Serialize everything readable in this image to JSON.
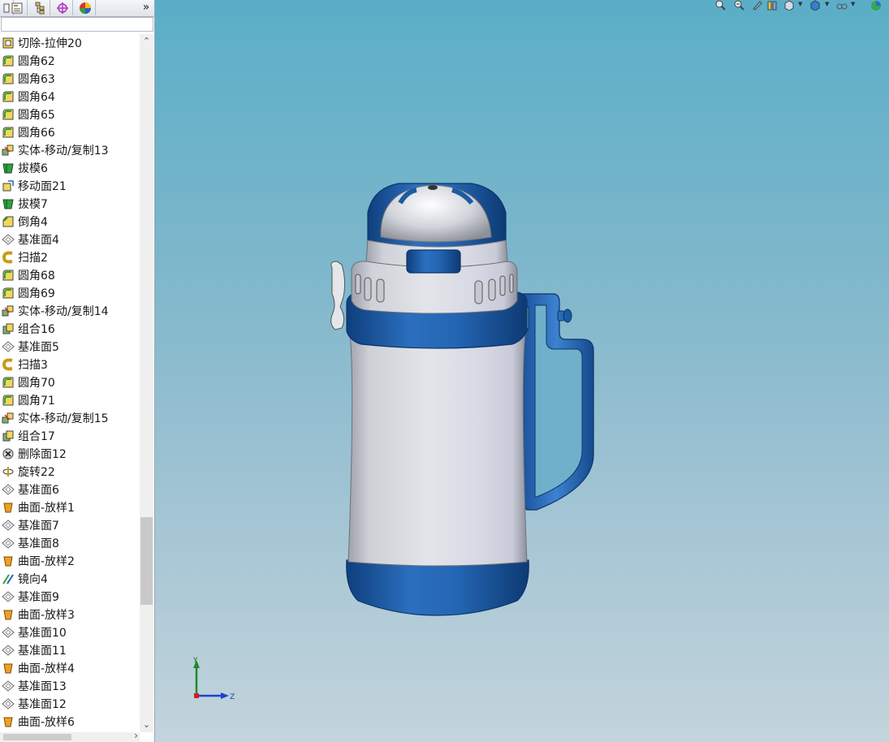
{
  "tabs": [
    {
      "name": "feature-manager-tab",
      "icon": "tree-icon"
    },
    {
      "name": "property-manager-tab",
      "icon": "property-sheet-icon"
    },
    {
      "name": "configuration-manager-tab",
      "icon": "configuration-icon"
    },
    {
      "name": "dimxpert-tab",
      "icon": "crosshair-icon"
    },
    {
      "name": "display-manager-tab",
      "icon": "appearance-pie-icon"
    }
  ],
  "tab_expand_label": "»",
  "feature_tree": [
    {
      "label": "切除-拉伸20",
      "icon": "cut-extrude-icon"
    },
    {
      "label": "圆角62",
      "icon": "fillet-icon"
    },
    {
      "label": "圆角63",
      "icon": "fillet-icon"
    },
    {
      "label": "圆角64",
      "icon": "fillet-icon"
    },
    {
      "label": "圆角65",
      "icon": "fillet-icon"
    },
    {
      "label": "圆角66",
      "icon": "fillet-icon"
    },
    {
      "label": "实体-移动/复制13",
      "icon": "move-copy-body-icon"
    },
    {
      "label": "拔模6",
      "icon": "draft-icon"
    },
    {
      "label": "移动面21",
      "icon": "move-face-icon"
    },
    {
      "label": "拔模7",
      "icon": "draft-icon"
    },
    {
      "label": "倒角4",
      "icon": "chamfer-icon"
    },
    {
      "label": "基准面4",
      "icon": "plane-icon"
    },
    {
      "label": "扫描2",
      "icon": "sweep-icon"
    },
    {
      "label": "圆角68",
      "icon": "fillet-icon"
    },
    {
      "label": "圆角69",
      "icon": "fillet-icon"
    },
    {
      "label": "实体-移动/复制14",
      "icon": "move-copy-body-icon"
    },
    {
      "label": "组合16",
      "icon": "combine-icon"
    },
    {
      "label": "基准面5",
      "icon": "plane-icon"
    },
    {
      "label": "扫描3",
      "icon": "sweep-icon"
    },
    {
      "label": "圆角70",
      "icon": "fillet-icon"
    },
    {
      "label": "圆角71",
      "icon": "fillet-icon"
    },
    {
      "label": "实体-移动/复制15",
      "icon": "move-copy-body-icon"
    },
    {
      "label": "组合17",
      "icon": "combine-icon"
    },
    {
      "label": "删除面12",
      "icon": "delete-face-icon"
    },
    {
      "label": "旋转22",
      "icon": "revolve-icon"
    },
    {
      "label": "基准面6",
      "icon": "plane-icon"
    },
    {
      "label": "曲面-放样1",
      "icon": "surface-loft-icon"
    },
    {
      "label": "基准面7",
      "icon": "plane-icon"
    },
    {
      "label": "基准面8",
      "icon": "plane-icon"
    },
    {
      "label": "曲面-放样2",
      "icon": "surface-loft-icon"
    },
    {
      "label": "镜向4",
      "icon": "mirror-icon"
    },
    {
      "label": "基准面9",
      "icon": "plane-icon"
    },
    {
      "label": "曲面-放样3",
      "icon": "surface-loft-icon"
    },
    {
      "label": "基准面10",
      "icon": "plane-icon"
    },
    {
      "label": "基准面11",
      "icon": "plane-icon"
    },
    {
      "label": "曲面-放样4",
      "icon": "surface-loft-icon"
    },
    {
      "label": "基准面13",
      "icon": "plane-icon"
    },
    {
      "label": "基准面12",
      "icon": "plane-icon"
    },
    {
      "label": "曲面-放样6",
      "icon": "surface-loft-icon"
    }
  ],
  "scroll": {
    "up_arrow": "⌃",
    "down_arrow": "⌄",
    "right_arrow": "›"
  },
  "splitter_glyph": "‹",
  "view_toolbar": [
    {
      "name": "zoom-to-fit-button",
      "icon": "zoom-fit-icon"
    },
    {
      "name": "zoom-to-area-button",
      "icon": "zoom-area-icon"
    },
    {
      "name": "previous-view-button",
      "icon": "previous-view-icon"
    },
    {
      "name": "section-view-button",
      "icon": "section-view-icon"
    },
    {
      "name": "view-orientation-button",
      "icon": "view-orientation-icon"
    },
    {
      "name": "display-style-button",
      "icon": "display-style-icon"
    },
    {
      "name": "hide-show-items-button",
      "icon": "hide-show-icon"
    },
    {
      "name": "edit-appearance-button",
      "icon": "appearance-icon"
    }
  ],
  "triad": {
    "y_label": "Y",
    "z_label": "Z"
  },
  "colors": {
    "viewport_top": "#5aaec7",
    "viewport_bottom": "#c3d4dc",
    "bottle_blue": "#1f5fa8",
    "bottle_silver": "#d9dbe2"
  }
}
